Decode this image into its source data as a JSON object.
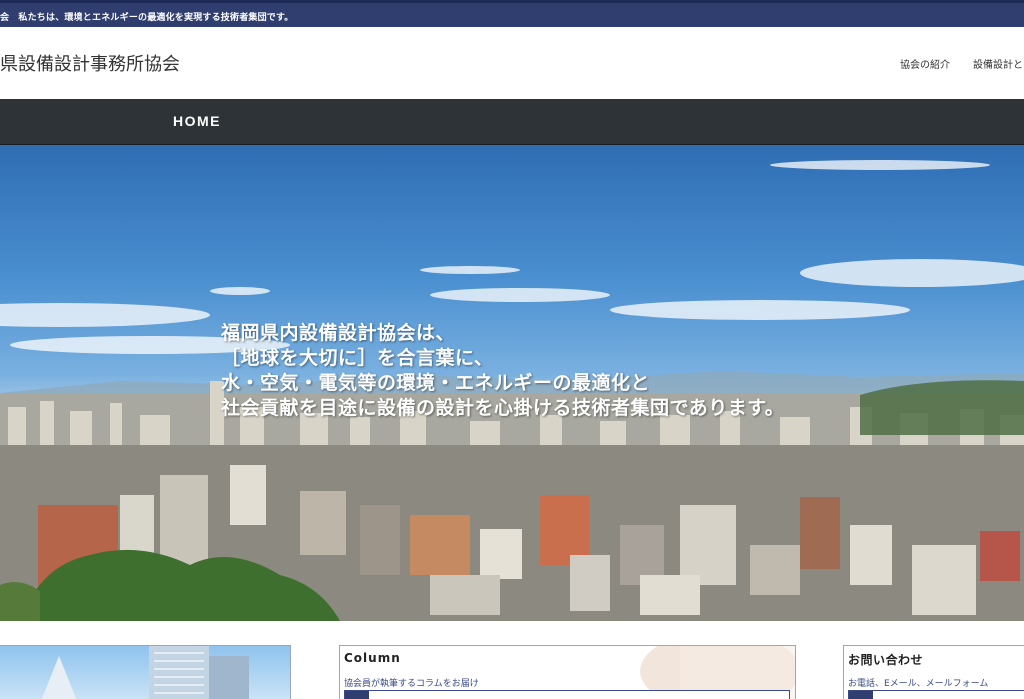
{
  "topbar": {
    "text": "会　私たちは、環境とエネルギーの最適化を実現する技術者集団です。"
  },
  "header": {
    "site_title": "県設備設計事務所協会",
    "nav": [
      {
        "label": "協会の紹介"
      },
      {
        "label": "設備設計と"
      }
    ]
  },
  "navbar": {
    "home_label": "HOME"
  },
  "hero": {
    "lines": [
      "福岡県内設備設計協会は、",
      "［地球を大切に］を合言葉に、",
      "水・空気・電気等の環境・エネルギーの最適化と",
      "社会貢献を目途に設備の設計を心掛ける技術者集団であります。"
    ]
  },
  "cards": {
    "column": {
      "title": "Column",
      "subtitle": "協会員が執筆するコラムをお届け"
    },
    "contact": {
      "title": "お問い合わせ",
      "subtitle": "お電話、Eメール、メールフォーム"
    }
  },
  "colors": {
    "topbar": "#2f3e6e",
    "navbar": "#2d3337",
    "card_border": "#9aa6bf",
    "accent": "#3a4a8a"
  }
}
